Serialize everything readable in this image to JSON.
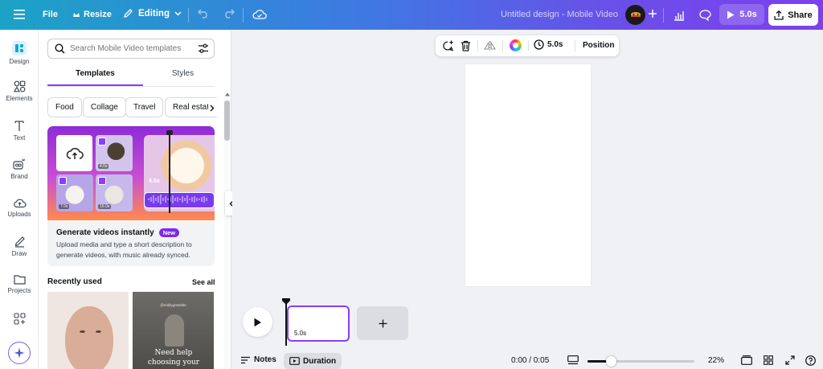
{
  "topbar": {
    "file_label": "File",
    "resize_label": "Resize",
    "editing_label": "Editing",
    "design_title": "Untitled design - Mobile Video",
    "play_duration": "5.0s",
    "share_label": "Share"
  },
  "sidebar": {
    "items": [
      {
        "label": "Design",
        "icon": "design-icon"
      },
      {
        "label": "Elements",
        "icon": "elements-icon"
      },
      {
        "label": "Text",
        "icon": "text-icon"
      },
      {
        "label": "Brand",
        "icon": "brand-icon"
      },
      {
        "label": "Uploads",
        "icon": "uploads-icon"
      },
      {
        "label": "Draw",
        "icon": "draw-icon"
      },
      {
        "label": "Projects",
        "icon": "projects-icon"
      },
      {
        "label": "",
        "icon": "apps-icon"
      }
    ]
  },
  "panel": {
    "search_placeholder": "Search Mobile Video templates",
    "tabs": [
      {
        "label": "Templates",
        "active": true
      },
      {
        "label": "Styles",
        "active": false
      }
    ],
    "chips": [
      "Food",
      "Collage",
      "Travel",
      "Real estate"
    ],
    "promo": {
      "title": "Generate videos instantly",
      "badge": "New",
      "description": "Upload media and type a short description to generate videos, with music already synced.",
      "clip_time": "4.0s",
      "thumb_times": [
        "4.0s",
        "7.0s",
        "15.0s"
      ]
    },
    "recently_used_title": "Recently used",
    "see_all_label": "See all",
    "recent_items": [
      {
        "text": ""
      },
      {
        "handle": "@reallygreatsite",
        "text": "Need help choosing your"
      }
    ]
  },
  "context_toolbar": {
    "duration": "5.0s",
    "position_label": "Position"
  },
  "timeline": {
    "page_duration": "5.0s"
  },
  "bottombar": {
    "notes_label": "Notes",
    "duration_label": "Duration",
    "time_display": "0:00 / 0:05",
    "zoom_label": "22%",
    "zoom_fraction": 0.22
  },
  "colors": {
    "accent": "#8b3dff",
    "topbar_start": "#1ba3c6",
    "topbar_end": "#7d3ff0"
  }
}
